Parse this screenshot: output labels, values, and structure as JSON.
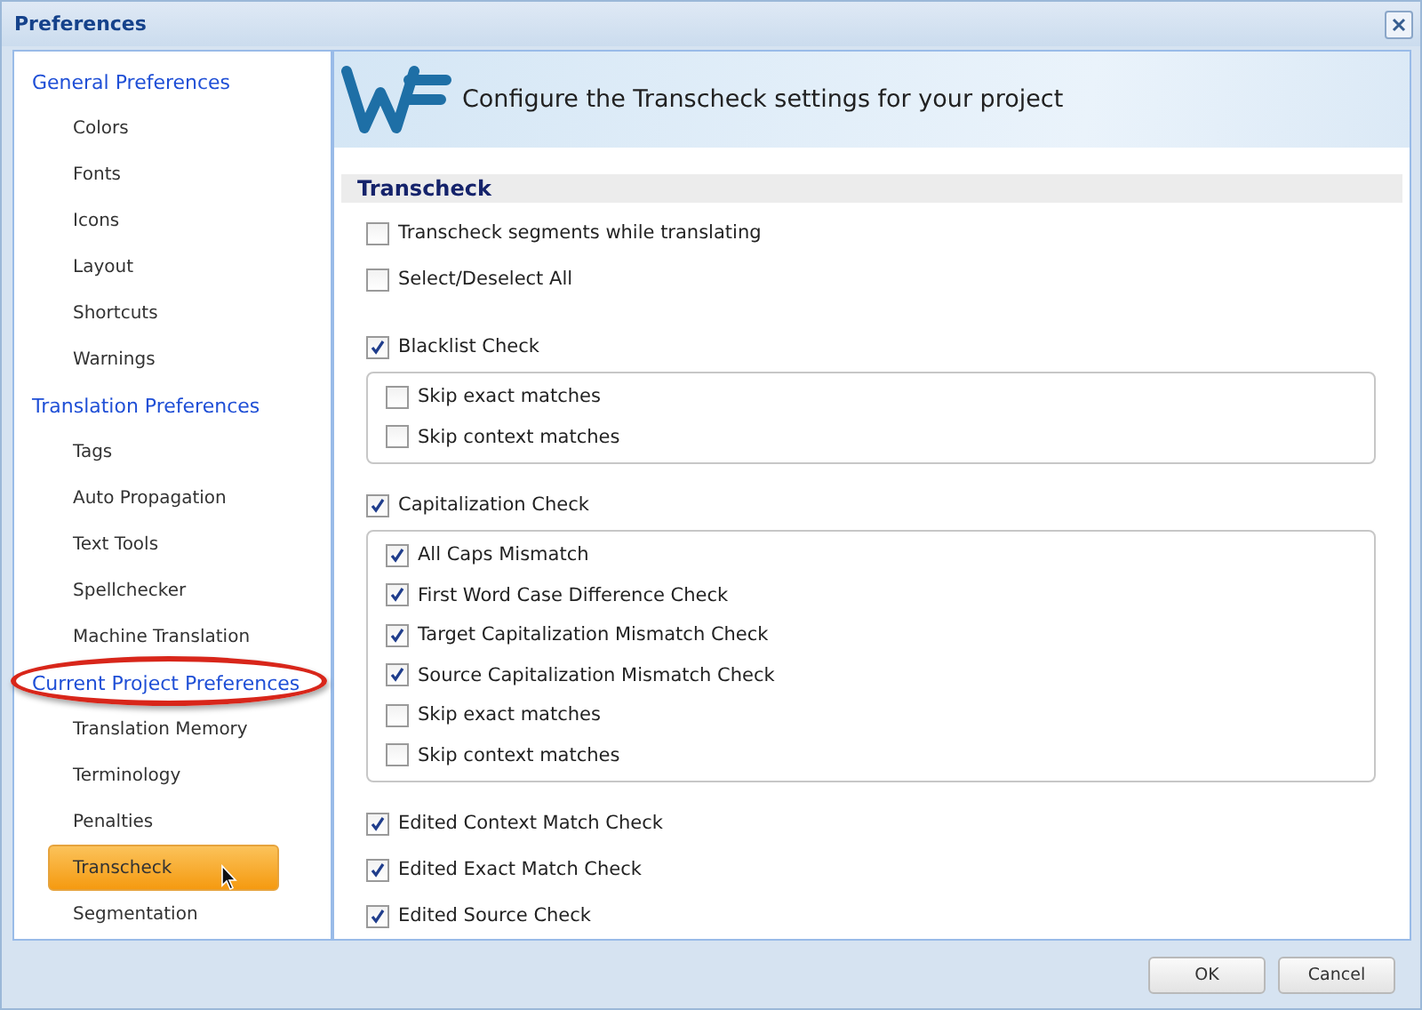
{
  "window": {
    "title": "Preferences"
  },
  "sidebar": {
    "groups": [
      {
        "heading": "General Preferences",
        "annotated": false,
        "items": [
          {
            "label": "Colors",
            "selected": false
          },
          {
            "label": "Fonts",
            "selected": false
          },
          {
            "label": "Icons",
            "selected": false
          },
          {
            "label": "Layout",
            "selected": false
          },
          {
            "label": "Shortcuts",
            "selected": false
          },
          {
            "label": "Warnings",
            "selected": false
          }
        ]
      },
      {
        "heading": "Translation Preferences",
        "annotated": false,
        "items": [
          {
            "label": "Tags",
            "selected": false
          },
          {
            "label": "Auto Propagation",
            "selected": false
          },
          {
            "label": "Text Tools",
            "selected": false
          },
          {
            "label": "Spellchecker",
            "selected": false
          },
          {
            "label": "Machine Translation",
            "selected": false
          }
        ]
      },
      {
        "heading": "Current Project Preferences",
        "annotated": true,
        "items": [
          {
            "label": "Translation Memory",
            "selected": false
          },
          {
            "label": "Terminology",
            "selected": false
          },
          {
            "label": "Penalties",
            "selected": false
          },
          {
            "label": "Transcheck",
            "selected": true
          },
          {
            "label": "Segmentation",
            "selected": false
          }
        ]
      }
    ]
  },
  "banner": {
    "text": "Configure the Transcheck settings for your project"
  },
  "section": {
    "title": "Transcheck",
    "blocks": [
      [
        {
          "kind": "check",
          "label": "Transcheck segments while translating",
          "checked": false
        },
        {
          "kind": "check",
          "label": "Select/Deselect All",
          "checked": false
        }
      ],
      [
        {
          "kind": "check",
          "label": "Blacklist Check",
          "checked": true
        },
        {
          "kind": "group",
          "items": [
            {
              "label": "Skip exact matches",
              "checked": false
            },
            {
              "label": "Skip context matches",
              "checked": false
            }
          ]
        },
        {
          "kind": "check",
          "label": "Capitalization Check",
          "checked": true
        },
        {
          "kind": "group",
          "items": [
            {
              "label": "All Caps Mismatch",
              "checked": true
            },
            {
              "label": "First Word Case Difference Check",
              "checked": true
            },
            {
              "label": "Target Capitalization Mismatch Check",
              "checked": true
            },
            {
              "label": "Source Capitalization Mismatch Check",
              "checked": true
            },
            {
              "label": "Skip exact matches",
              "checked": false
            },
            {
              "label": "Skip context matches",
              "checked": false
            }
          ]
        },
        {
          "kind": "check",
          "label": "Edited Context Match Check",
          "checked": true
        },
        {
          "kind": "check",
          "label": "Edited Exact Match Check",
          "checked": true
        },
        {
          "kind": "check",
          "label": "Edited Source Check",
          "checked": true
        }
      ]
    ]
  },
  "buttons": [
    "OK",
    "Cancel"
  ]
}
